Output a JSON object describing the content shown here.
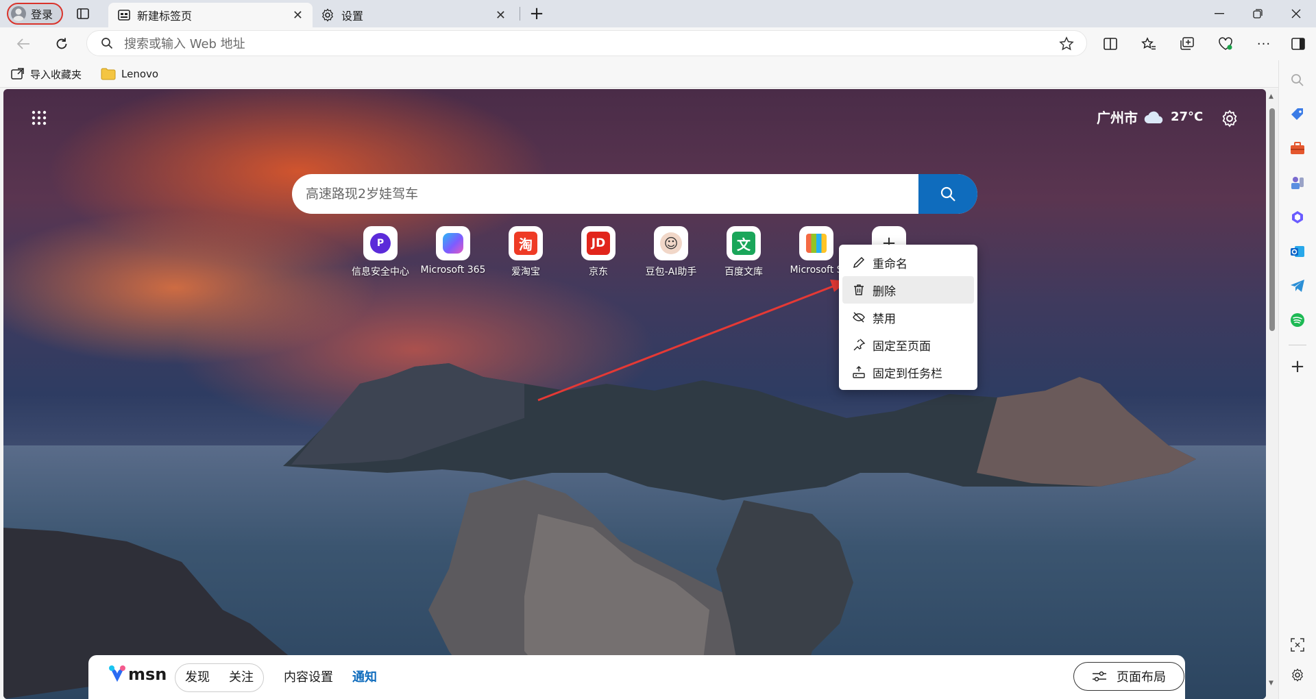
{
  "profile": {
    "label": "登录"
  },
  "tabs": [
    {
      "label": "新建标签页",
      "active": true
    },
    {
      "label": "设置",
      "active": false
    }
  ],
  "address": {
    "placeholder": "搜索或输入 Web 地址"
  },
  "bookmarks": [
    {
      "label": "导入收藏夹",
      "icon": "import-icon"
    },
    {
      "label": "Lenovo",
      "icon": "folder-icon"
    }
  ],
  "weather": {
    "city": "广州市",
    "temp": "27°C",
    "icon": "cloud-icon"
  },
  "search": {
    "placeholder": "高速路现2岁娃驾车"
  },
  "tiles": [
    {
      "label": "信息安全中心",
      "glyph": "P",
      "color": "#5b2bd9"
    },
    {
      "label": "Microsoft 365",
      "glyph": "365",
      "color": "#7d5cff"
    },
    {
      "label": "爱淘宝",
      "glyph": "淘",
      "color": "#ee3b25"
    },
    {
      "label": "京东",
      "glyph": "JD",
      "color": "#e1251b"
    },
    {
      "label": "豆包-AI助手",
      "glyph": "☺",
      "color": "#333333"
    },
    {
      "label": "百度文库",
      "glyph": "文",
      "color": "#1aa65a"
    },
    {
      "label": "Microsoft S",
      "glyph": "▦",
      "color": "#6aa5e0"
    }
  ],
  "context_menu": {
    "items": [
      {
        "label": "重命名",
        "icon": "pencil-icon"
      },
      {
        "label": "删除",
        "icon": "trash-icon"
      },
      {
        "label": "禁用",
        "icon": "disable-icon"
      },
      {
        "label": "固定至页面",
        "icon": "pin-icon"
      },
      {
        "label": "固定到任务栏",
        "icon": "taskbar-pin-icon"
      }
    ]
  },
  "msn": {
    "logo": "msn",
    "tabs": [
      "发现",
      "关注"
    ],
    "content_settings": "内容设置",
    "notifications": "通知",
    "layout_button": "页面布局"
  },
  "colors": {
    "accent": "#0f6cbd",
    "annotation": "#e53935"
  }
}
